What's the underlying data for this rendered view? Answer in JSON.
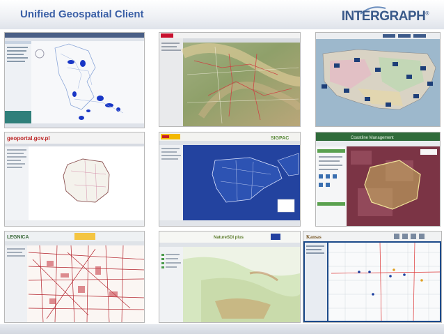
{
  "header": {
    "title": "Unified Geospatial Client",
    "logo_text": "INTERGRAPH",
    "logo_mark": "®",
    "title_color": "#3a5fa6",
    "logo_color": "#3a5a8a"
  },
  "screenshots": [
    {
      "id": "tile-1",
      "theme": "blue-region-map"
    },
    {
      "id": "tile-2",
      "theme": "satellite-road-map"
    },
    {
      "id": "tile-3",
      "theme": "us-weather-map"
    },
    {
      "id": "tile-4",
      "header_text": "geoportal.gov.pl",
      "theme": "poland-map"
    },
    {
      "id": "tile-5",
      "header_text": "SIGPAC",
      "theme": "iberia-map"
    },
    {
      "id": "tile-6",
      "header_text": "Coastline Management",
      "theme": "polygon-overlay"
    },
    {
      "id": "tile-7",
      "header_text": "LEGNICA",
      "theme": "city-street-map"
    },
    {
      "id": "tile-8",
      "header_text": "NatureSDI plus",
      "theme": "europe-terrain-map"
    },
    {
      "id": "tile-9",
      "header_text": "Kansas",
      "theme": "kansas-road-map"
    }
  ]
}
